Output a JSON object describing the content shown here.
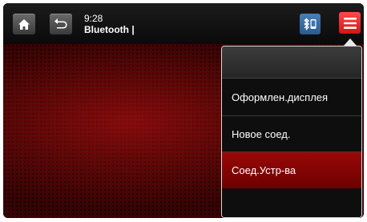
{
  "top_bar": {
    "time": "9:28",
    "status_text": "Bluetooth |",
    "home_icon": "home-icon",
    "back_icon": "back-arrow-icon",
    "bluetooth_phone_icon": "bluetooth-phone-icon",
    "menu_icon": "hamburger-menu-icon"
  },
  "menu": {
    "items": [
      {
        "label": "Оформлен.дисплея",
        "selected": false
      },
      {
        "label": "Новое соед.",
        "selected": false
      },
      {
        "label": "Соед.Устр-ва",
        "selected": true
      }
    ]
  },
  "colors": {
    "accent_red": "#e31b1b",
    "selected_item": "#8a0000",
    "bluetooth_blue": "#3b74b0"
  }
}
